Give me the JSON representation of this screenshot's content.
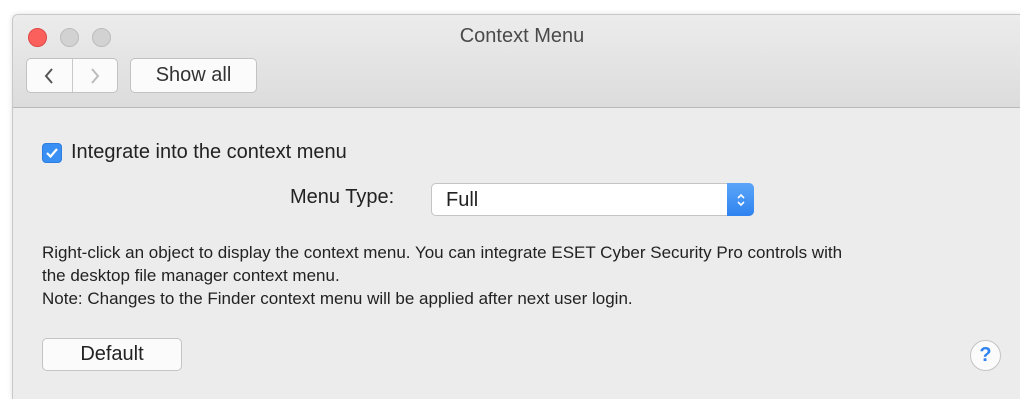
{
  "window": {
    "title": "Context Menu",
    "show_all_label": "Show all"
  },
  "icons": {
    "back": "chevron-left-icon",
    "forward": "chevron-right-icon",
    "checkbox": "checkmark-icon",
    "select": "up-down-arrows-icon",
    "help": "question-mark"
  },
  "colors": {
    "accent": "#3a8ff5",
    "close_button": "#fc605c",
    "background": "#ececec"
  },
  "settings": {
    "integrate_label": "Integrate into the context menu",
    "integrate_checked": true,
    "menu_type_label": "Menu Type:",
    "menu_type_value": "Full"
  },
  "description": {
    "line1": "Right-click an object to display the context menu. You can integrate ESET Cyber Security Pro controls with",
    "line2": "the desktop file manager context menu.",
    "line3": "Note: Changes to the Finder context menu will be applied after next user login."
  },
  "footer": {
    "default_label": "Default",
    "help_symbol": "?"
  }
}
